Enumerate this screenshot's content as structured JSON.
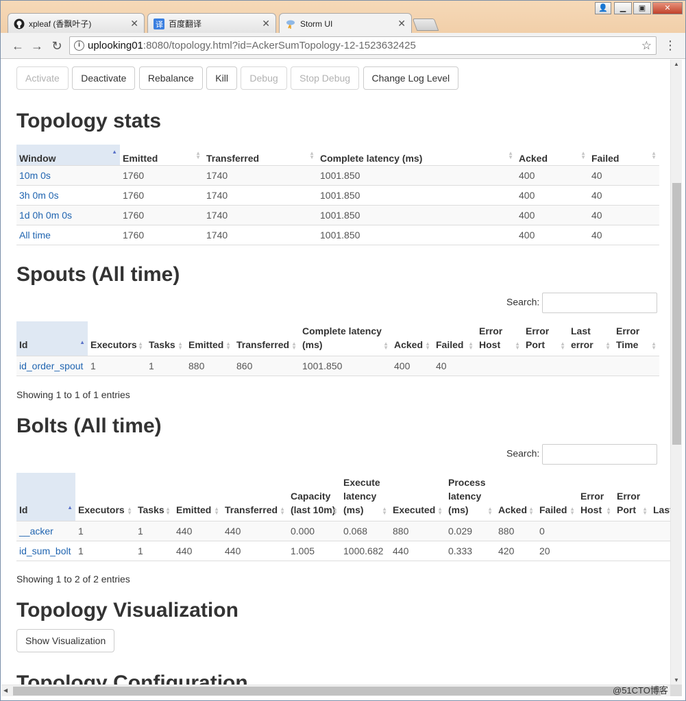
{
  "browser": {
    "tabs": [
      {
        "title": "xpleaf (香飘叶子)",
        "icon": "github-icon"
      },
      {
        "title": "百度翻译",
        "icon": "baidu-translate-icon"
      },
      {
        "title": "Storm UI",
        "icon": "storm-icon"
      }
    ],
    "url_host": "uplooking01",
    "url_rest": ":8080/topology.html?id=AckerSumTopology-12-1523632425"
  },
  "actions": {
    "activate": "Activate",
    "deactivate": "Deactivate",
    "rebalance": "Rebalance",
    "kill": "Kill",
    "debug": "Debug",
    "stop_debug": "Stop Debug",
    "change_log_level": "Change Log Level"
  },
  "topology_stats": {
    "title": "Topology stats",
    "columns": [
      "Window",
      "Emitted",
      "Transferred",
      "Complete latency (ms)",
      "Acked",
      "Failed"
    ],
    "rows": [
      [
        "10m 0s",
        "1760",
        "1740",
        "1001.850",
        "400",
        "40"
      ],
      [
        "3h 0m 0s",
        "1760",
        "1740",
        "1001.850",
        "400",
        "40"
      ],
      [
        "1d 0h 0m 0s",
        "1760",
        "1740",
        "1001.850",
        "400",
        "40"
      ],
      [
        "All time",
        "1760",
        "1740",
        "1001.850",
        "400",
        "40"
      ]
    ]
  },
  "spouts": {
    "title": "Spouts (All time)",
    "search_label": "Search:",
    "columns": [
      "Id",
      "Executors",
      "Tasks",
      "Emitted",
      "Transferred",
      "Complete latency (ms)",
      "Acked",
      "Failed",
      "Error Host",
      "Error Port",
      "Last error",
      "Error Time"
    ],
    "rows": [
      [
        "id_order_spout",
        "1",
        "1",
        "880",
        "860",
        "1001.850",
        "400",
        "40",
        "",
        "",
        "",
        ""
      ]
    ],
    "info": "Showing 1 to 1 of 1 entries"
  },
  "bolts": {
    "title": "Bolts (All time)",
    "search_label": "Search:",
    "columns": [
      "Id",
      "Executors",
      "Tasks",
      "Emitted",
      "Transferred",
      "Capacity (last 10m)",
      "Execute latency (ms)",
      "Executed",
      "Process latency (ms)",
      "Acked",
      "Failed",
      "Error Host",
      "Error Port",
      "Last error"
    ],
    "rows": [
      [
        "__acker",
        "1",
        "1",
        "440",
        "440",
        "0.000",
        "0.068",
        "880",
        "0.029",
        "880",
        "0",
        "",
        "",
        ""
      ],
      [
        "id_sum_bolt",
        "1",
        "1",
        "440",
        "440",
        "1.005",
        "1000.682",
        "440",
        "0.333",
        "420",
        "20",
        "",
        "",
        ""
      ]
    ],
    "info": "Showing 1 to 2 of 2 entries"
  },
  "visualization": {
    "title": "Topology Visualization",
    "button": "Show Visualization"
  },
  "configuration": {
    "title": "Topology Configuration"
  },
  "watermark": "@51CTO博客"
}
